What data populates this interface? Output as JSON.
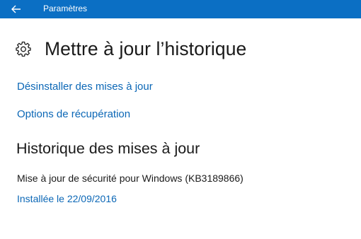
{
  "titlebar": {
    "app_title": "Paramètres",
    "back_icon": "arrow-left-icon",
    "background_color": "#0b6fc4"
  },
  "header": {
    "icon": "gear-icon",
    "title": "Mettre à jour l’historique"
  },
  "links": {
    "uninstall": "Désinstaller des mises à jour",
    "recovery": "Options de récupération"
  },
  "history": {
    "section_title": "Historique des mises à jour",
    "items": [
      {
        "name": "Mise à jour de sécurité pour Windows (KB3189866)",
        "status": "Installée le 22/09/2016"
      }
    ]
  },
  "colors": {
    "accent": "#0b67b6",
    "text": "#1a1a1a"
  }
}
